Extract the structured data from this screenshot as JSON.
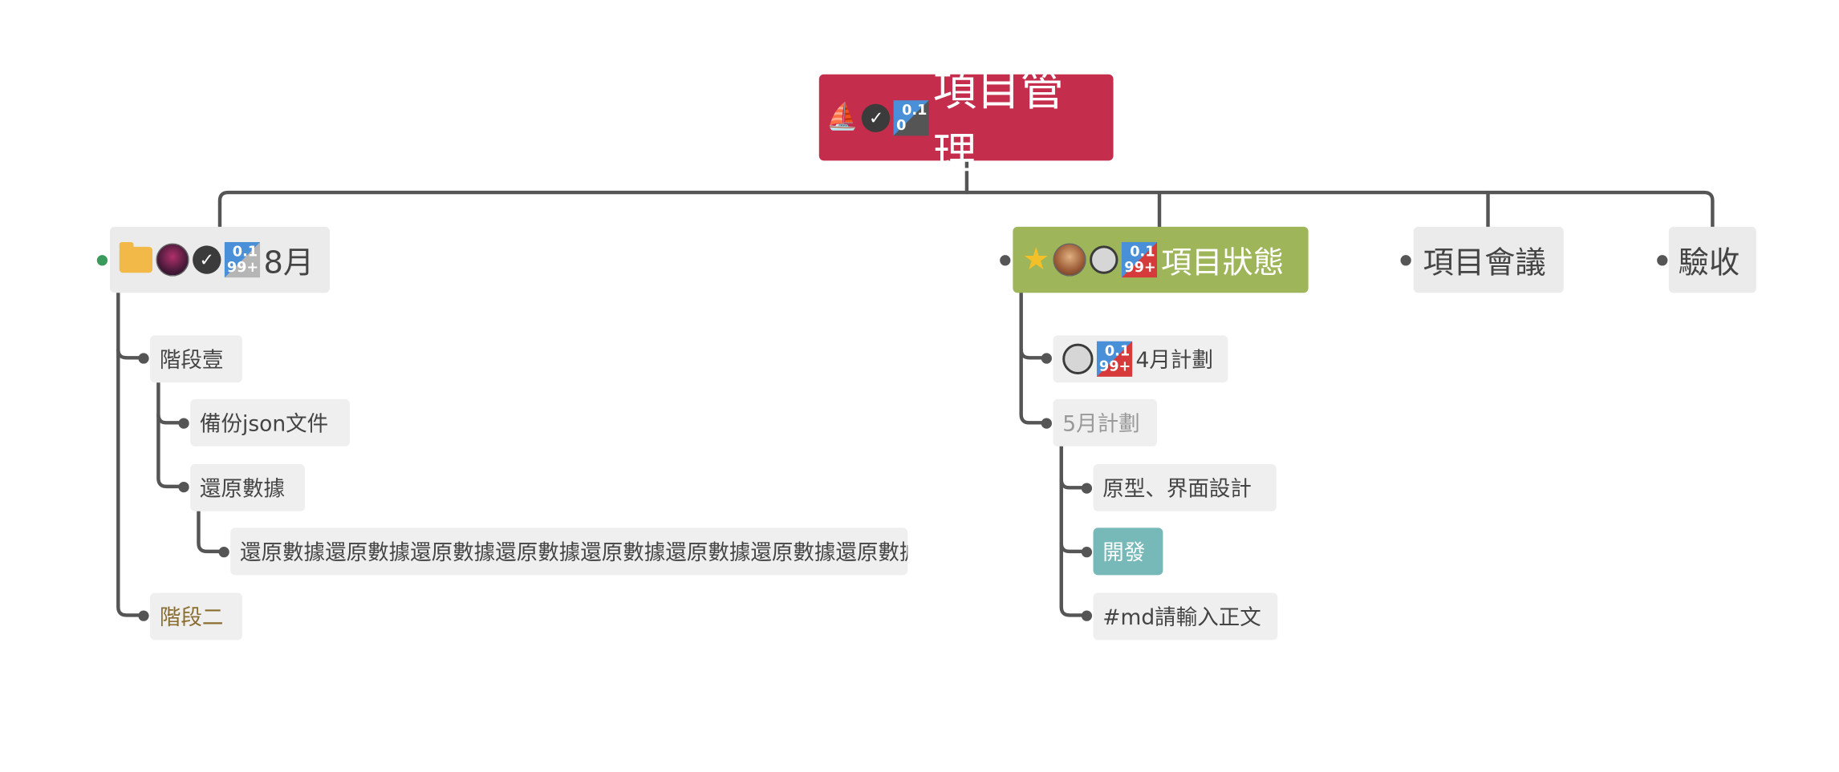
{
  "colors": {
    "root": "#c42e4c",
    "status_node": "#9fb55a",
    "dev_node": "#77b8b8",
    "line": "#555555",
    "stage2_text": "#8a6d2f",
    "may_text": "#999999"
  },
  "root": {
    "title": "項目管理",
    "icons": [
      "sailboat-icon",
      "check-circle-icon",
      "progress-0.1-icon"
    ],
    "progress": {
      "top": "0.1",
      "bottom": "0"
    }
  },
  "branches": {
    "august": {
      "label": "8月",
      "icons": [
        "folder-icon",
        "avatar-icon",
        "check-circle-icon",
        "progress-icon"
      ],
      "progress": {
        "top": "0.1",
        "bottom": "99+"
      },
      "children": [
        {
          "label": "階段壹",
          "children": [
            {
              "label": "備份json文件"
            },
            {
              "label": "還原數據",
              "children": [
                {
                  "label": "還原數據還原數據還原數據還原數據還原數據還原數據還原數據還原數據..."
                }
              ]
            }
          ]
        },
        {
          "label": "階段二"
        }
      ]
    },
    "status": {
      "label": "項目狀態",
      "icons": [
        "star-icon",
        "avatar-icon",
        "empty-circle-icon",
        "progress-icon"
      ],
      "progress": {
        "top": "0.1",
        "bottom": "99+"
      },
      "children": [
        {
          "label": "4月計劃",
          "icons": [
            "empty-circle-icon",
            "progress-icon"
          ],
          "progress": {
            "top": "0.1",
            "bottom": "99+"
          }
        },
        {
          "label": "5月計劃",
          "children": [
            {
              "label": "原型、界面設計"
            },
            {
              "label": "開發"
            },
            {
              "label": "#md請輸入正文"
            }
          ]
        }
      ]
    },
    "meeting": {
      "label": "項目會議"
    },
    "acceptance": {
      "label": "驗收"
    }
  }
}
